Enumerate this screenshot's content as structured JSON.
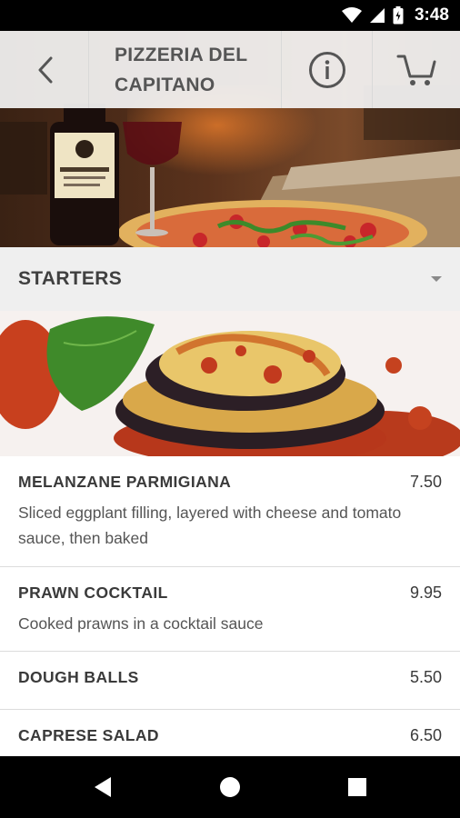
{
  "status_bar": {
    "time": "3:48",
    "icons": [
      "wifi-icon",
      "signal-icon",
      "battery-icon"
    ]
  },
  "header": {
    "title": "PIZZERIA DEL CAPITANO",
    "icons": {
      "back": "chevron-left-icon",
      "info": "info-icon",
      "cart": "cart-icon"
    }
  },
  "category": {
    "title": "STARTERS",
    "expand_icon": "caret-down-icon"
  },
  "menu": {
    "items": [
      {
        "name": "MELANZANE PARMIGIANA",
        "price": "7.50",
        "description": "Sliced eggplant ﬁlling, layered with cheese and tomato sauce, then baked"
      },
      {
        "name": "PRAWN COCKTAIL",
        "price": "9.95",
        "description": "Cooked prawns in a cocktail sauce"
      },
      {
        "name": "DOUGH BALLS",
        "price": "5.50",
        "description": ""
      },
      {
        "name": "CAPRESE SALAD",
        "price": "6.50",
        "description": ""
      }
    ]
  },
  "nav_bar": {
    "icons": [
      "back-triangle-icon",
      "home-circle-icon",
      "recents-square-icon"
    ]
  },
  "colors": {
    "header_bg": "#f5f5f5",
    "category_bg": "#efefef",
    "text_dark": "#3a3a3a",
    "text_desc": "#555555",
    "system_bars": "#000000"
  }
}
